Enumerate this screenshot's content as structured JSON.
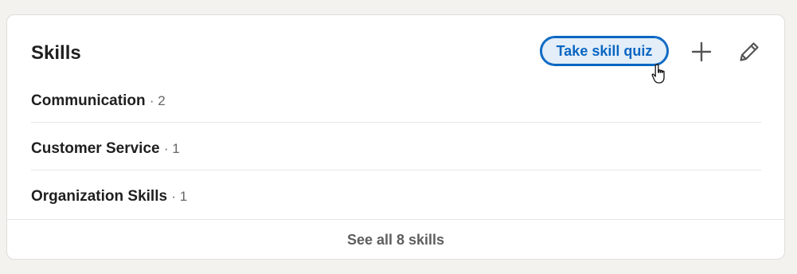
{
  "card": {
    "title": "Skills",
    "take_quiz_label": "Take skill quiz",
    "add_icon": "plus-icon",
    "edit_icon": "pencil-icon"
  },
  "skills": [
    {
      "name": "Communication",
      "count": "· 2"
    },
    {
      "name": "Customer Service",
      "count": "· 1"
    },
    {
      "name": "Organization Skills",
      "count": "· 1"
    }
  ],
  "footer": {
    "see_all_label": "See all 8 skills"
  },
  "colors": {
    "accent": "#0a66c2",
    "accent_bg": "#e3eef8",
    "page_bg": "#f4f2ee",
    "text": "#1f1f1f",
    "muted": "#666666"
  }
}
